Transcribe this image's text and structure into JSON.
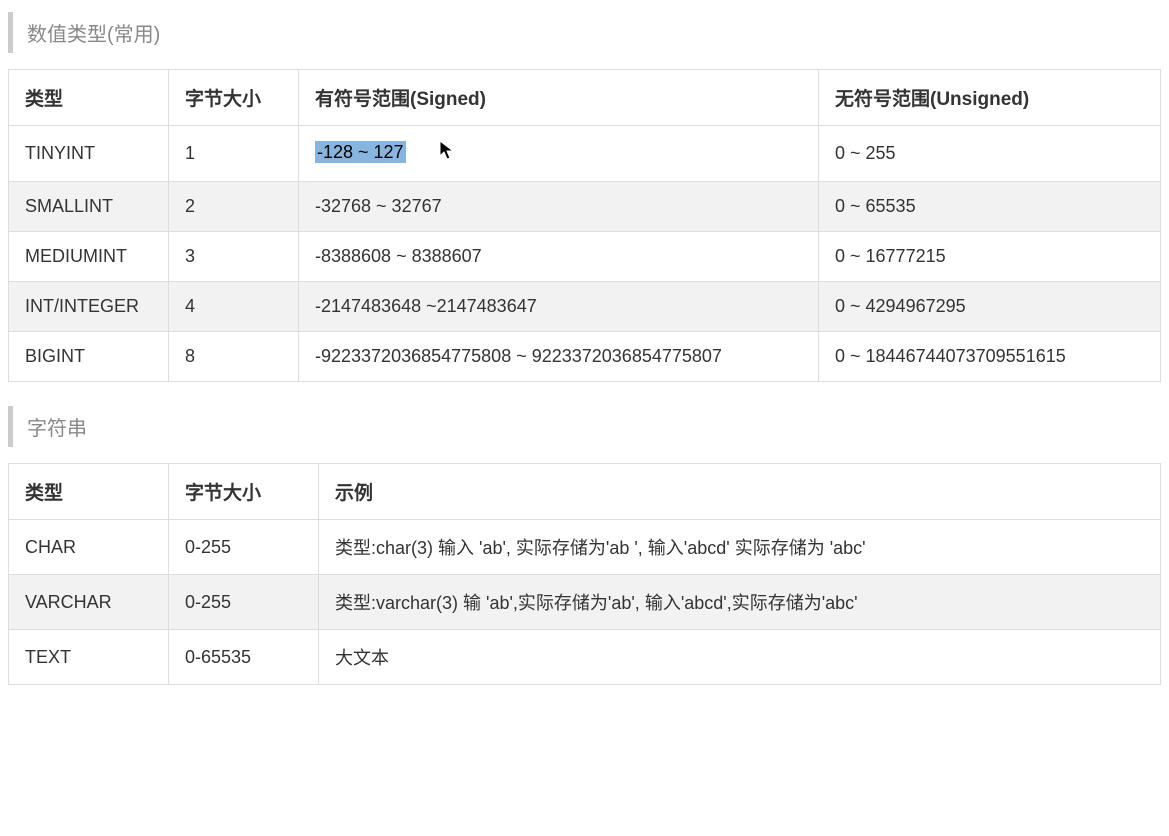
{
  "numeric": {
    "title": "数值类型(常用)",
    "headers": {
      "type": "类型",
      "bytes": "字节大小",
      "signed": "有符号范围(Signed)",
      "unsigned": "无符号范围(Unsigned)"
    },
    "rows": [
      {
        "type": "TINYINT",
        "bytes": "1",
        "signed": "-128 ~ 127",
        "unsigned": "0 ~ 255",
        "highlighted": true
      },
      {
        "type": "SMALLINT",
        "bytes": "2",
        "signed": "-32768 ~ 32767",
        "unsigned": "0 ~ 65535"
      },
      {
        "type": "MEDIUMINT",
        "bytes": "3",
        "signed": "-8388608 ~ 8388607",
        "unsigned": "0 ~ 16777215"
      },
      {
        "type": "INT/INTEGER",
        "bytes": "4",
        "signed": "-2147483648 ~2147483647",
        "unsigned": "0 ~ 4294967295"
      },
      {
        "type": "BIGINT",
        "bytes": "8",
        "signed": "-9223372036854775808 ~ 9223372036854775807",
        "unsigned": "0 ~ 18446744073709551615"
      }
    ]
  },
  "string": {
    "title": "字符串",
    "headers": {
      "type": "类型",
      "bytes": "字节大小",
      "example": "示例"
    },
    "rows": [
      {
        "type": "CHAR",
        "bytes": "0-255",
        "example": "类型:char(3) 输入 'ab', 实际存储为'ab ', 输入'abcd' 实际存储为 'abc'"
      },
      {
        "type": "VARCHAR",
        "bytes": "0-255",
        "example": "类型:varchar(3) 输 'ab',实际存储为'ab', 输入'abcd',实际存储为'abc'"
      },
      {
        "type": "TEXT",
        "bytes": "0-65535",
        "example": "大文本"
      }
    ]
  }
}
